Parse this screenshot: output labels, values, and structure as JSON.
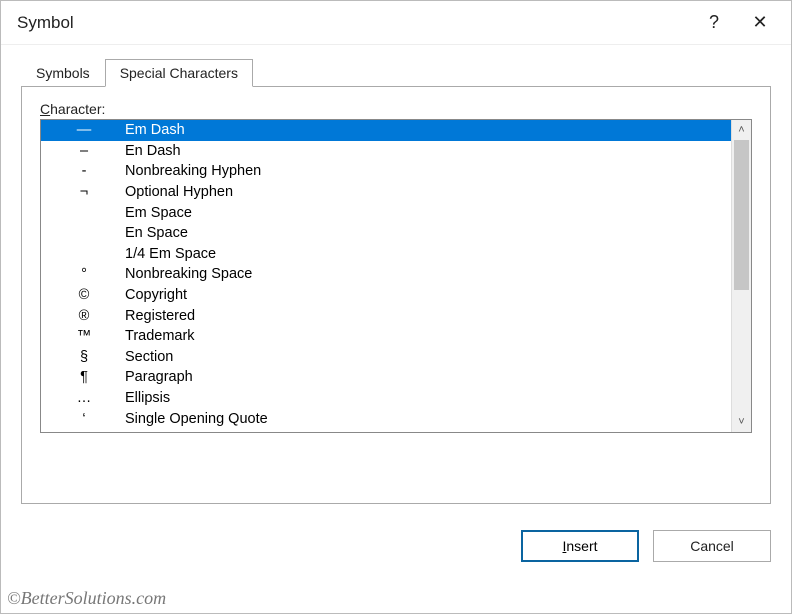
{
  "window": {
    "title": "Symbol",
    "help_tooltip": "?",
    "close_tooltip": "✕"
  },
  "tabs": {
    "symbols_label": "Symbols",
    "special_label": "Special Characters",
    "active": "special"
  },
  "list_label_prefix": "C",
  "list_label_rest": "haracter:",
  "characters": [
    {
      "symbol": "—",
      "name": "Em Dash",
      "selected": true
    },
    {
      "symbol": "–",
      "name": "En Dash"
    },
    {
      "symbol": "-",
      "name": "Nonbreaking Hyphen"
    },
    {
      "symbol": "¬",
      "name": "Optional Hyphen"
    },
    {
      "symbol": "",
      "name": "Em Space"
    },
    {
      "symbol": "",
      "name": "En Space"
    },
    {
      "symbol": "",
      "name": "1/4 Em Space"
    },
    {
      "symbol": "°",
      "name": "Nonbreaking Space"
    },
    {
      "symbol": "©",
      "name": "Copyright"
    },
    {
      "symbol": "®",
      "name": "Registered"
    },
    {
      "symbol": "™",
      "name": "Trademark"
    },
    {
      "symbol": "§",
      "name": "Section"
    },
    {
      "symbol": "¶",
      "name": "Paragraph"
    },
    {
      "symbol": "…",
      "name": "Ellipsis"
    },
    {
      "symbol": "‘",
      "name": "Single Opening Quote"
    }
  ],
  "buttons": {
    "insert_prefix": "I",
    "insert_rest": "nsert",
    "cancel": "Cancel"
  },
  "scroll": {
    "up": "˄",
    "down": "˅"
  },
  "watermark": "©BetterSolutions.com"
}
